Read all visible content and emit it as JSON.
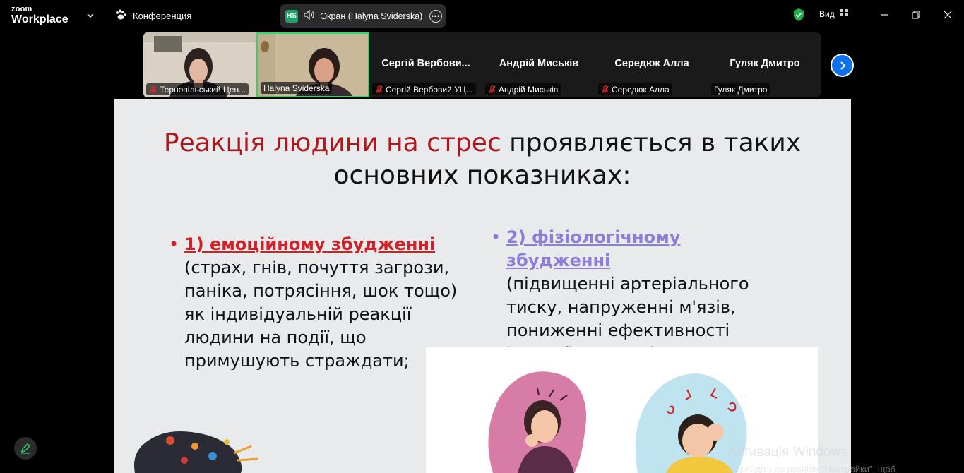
{
  "app": {
    "logo_top": "zoom",
    "logo_bottom": "Workplace",
    "meeting_menu": "Конференция",
    "share_badge": "HS",
    "share_title": "Экран (Halyna Sviderska)",
    "more_label": "•••",
    "view_label": "Вид"
  },
  "participants": [
    {
      "big_name": "",
      "label": "Тернопільський Цен...",
      "muted": true,
      "video": true
    },
    {
      "big_name": "",
      "label": "Halyna Sviderska",
      "muted": false,
      "video": true,
      "active": true
    },
    {
      "big_name": "Сергій  Вербови...",
      "label": "Сергій Вербовий УЦ...",
      "muted": true,
      "video": false
    },
    {
      "big_name": "Андрій Миськів",
      "label": "Андрій Миськів",
      "muted": true,
      "video": false
    },
    {
      "big_name": "Середюк Алла",
      "label": "Середюк Алла",
      "muted": true,
      "video": false
    },
    {
      "big_name": "Гуляк Дмитро",
      "label": "Гуляк Дмитро",
      "muted": false,
      "video": false
    }
  ],
  "slide": {
    "title_red": "Реакція людини на стрес",
    "title_rest_1": " проявляється в таких",
    "title_rest_2": "основних показниках:",
    "col1_head": "1) емоційному збудженні",
    "col1_body": "(страх, гнів, почуття загрози, паніка, потрясіння, шок тощо) як індивідуальній реакції людини на події, що примушують страждати;",
    "col2_head": "2) фізіологічному збудженні",
    "col2_body": "(підвищенні артеріального тиску, напруженні м'язів, пониженні ефективності імунної системи)."
  },
  "watermark": {
    "line1": "Активація Windows",
    "line2": "Перейдіть до розділу \"Настройки\", щоб"
  },
  "colors": {
    "accent_green": "#2fd66c",
    "accent_blue": "#0e72ed",
    "title_red": "#b1161c",
    "bullet_red": "#d31f26",
    "bullet_purple": "#8b7fd8"
  }
}
